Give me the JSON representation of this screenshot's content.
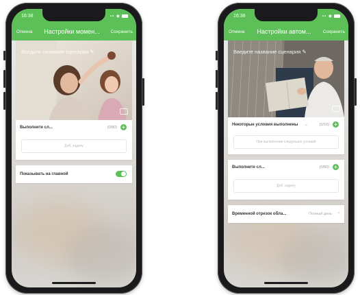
{
  "left_phone": {
    "status": {
      "time": "16:38",
      "icons": "▪▪ ◉"
    },
    "nav": {
      "cancel": "Отмена",
      "title": "Настройки момен...",
      "save": "Сохранить"
    },
    "scene_name_placeholder": "Введите название сценария ✎",
    "actions": {
      "label": "Выполните сл...",
      "count": "(0/80)",
      "empty": "Доб. задачу"
    },
    "home_toggle": {
      "label": "Показывать на главной",
      "on": true
    }
  },
  "right_phone": {
    "status": {
      "time": "16:38",
      "icons": "▪▪ ◉"
    },
    "nav": {
      "cancel": "Отмена",
      "title": "Настройки автом...",
      "save": "Сохранить"
    },
    "scene_name_placeholder": "Введите название сценария ✎",
    "conditions": {
      "label": "Некоторые условия выполнены",
      "count": "(0/10)",
      "empty": "При выполнении следующих условий"
    },
    "actions": {
      "label": "Выполните сл...",
      "count": "(0/80)",
      "empty": "Доб. задачу"
    },
    "time_window": {
      "label": "Временной отрезок обла...",
      "value": "Полный день"
    }
  },
  "colors": {
    "accent": "#5cbf57"
  }
}
